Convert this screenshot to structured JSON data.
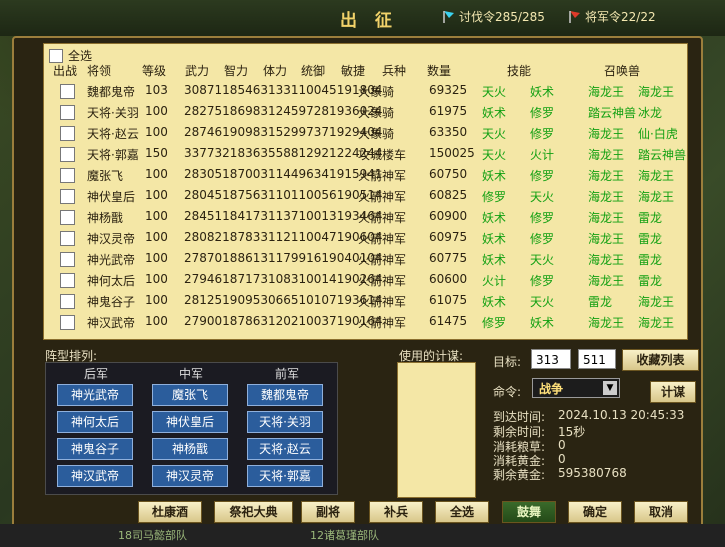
{
  "header": {
    "title": "出 征",
    "tao_fa": "讨伐令285/285",
    "jiang_jun": "将军令22/22"
  },
  "list": {
    "select_all": "全选",
    "columns": [
      "出战",
      "将领",
      "等级",
      "武力",
      "智力",
      "体力",
      "统御",
      "敏捷",
      "兵种",
      "数量",
      "技能",
      "召唤兽"
    ],
    "rows": [
      {
        "name": "魏都鬼帝",
        "level": "103",
        "stats": "30871185463133110045191804",
        "troop": "大象骑",
        "qty": "69325",
        "s1": "天火",
        "s2": "妖术",
        "b1": "海龙王",
        "b2": "海龙王"
      },
      {
        "name": "天将·关羽",
        "level": "100",
        "stats": "28275186983124597281936024",
        "troop": "大象骑",
        "qty": "61975",
        "s1": "妖术",
        "s2": "修罗",
        "b1": "踏云神兽",
        "b2": "冰龙"
      },
      {
        "name": "天将·赵云",
        "level": "100",
        "stats": "28746190983152997371929404",
        "troop": "大象骑",
        "qty": "63350",
        "s1": "天火",
        "s2": "修罗",
        "b1": "海龙王",
        "b2": "仙·白虎"
      },
      {
        "name": "天将·郭嘉",
        "level": "150",
        "stats": "33773218363558812921224244",
        "troop": "攻城楼车",
        "qty": "150025",
        "s1": "天火",
        "s2": "火计",
        "b1": "海龙王",
        "b2": "踏云神兽"
      },
      {
        "name": "魔张飞",
        "level": "100",
        "stats": "28305187003114496341915941",
        "troop": "火箭神军",
        "qty": "60750",
        "s1": "妖术",
        "s2": "修罗",
        "b1": "海龙王",
        "b2": "海龙王"
      },
      {
        "name": "神伏皇后",
        "level": "100",
        "stats": "28045187563110110056190514",
        "troop": "火箭神军",
        "qty": "60825",
        "s1": "修罗",
        "s2": "天火",
        "b1": "海龙王",
        "b2": "海龙王"
      },
      {
        "name": "神杨戬",
        "level": "100",
        "stats": "28451184173113710013193464",
        "troop": "火箭神军",
        "qty": "60900",
        "s1": "妖术",
        "s2": "修罗",
        "b1": "海龙王",
        "b2": "雷龙"
      },
      {
        "name": "神汉灵帝",
        "level": "100",
        "stats": "28082187833112110047190604",
        "troop": "火箭神军",
        "qty": "60975",
        "s1": "妖术",
        "s2": "修罗",
        "b1": "海龙王",
        "b2": "雷龙"
      },
      {
        "name": "神光武帝",
        "level": "100",
        "stats": "27870188613117991619040104",
        "troop": "火箭神军",
        "qty": "60775",
        "s1": "妖术",
        "s2": "天火",
        "b1": "海龙王",
        "b2": "雷龙"
      },
      {
        "name": "神何太后",
        "level": "100",
        "stats": "27946187173108310014190264",
        "troop": "火箭神军",
        "qty": "60600",
        "s1": "火计",
        "s2": "修罗",
        "b1": "海龙王",
        "b2": "雷龙"
      },
      {
        "name": "神鬼谷子",
        "level": "100",
        "stats": "28125190953066510107193614",
        "troop": "火箭神军",
        "qty": "61075",
        "s1": "妖术",
        "s2": "天火",
        "b1": "雷龙",
        "b2": "海龙王"
      },
      {
        "name": "神汉武帝",
        "level": "100",
        "stats": "27900187863120210037190164",
        "troop": "火箭神军",
        "qty": "61475",
        "s1": "修罗",
        "s2": "妖术",
        "b1": "海龙王",
        "b2": "海龙王"
      }
    ]
  },
  "formation": {
    "title": "阵型排列:",
    "headers": [
      "后军",
      "中军",
      "前军"
    ],
    "cells": [
      [
        "神光武帝",
        "魔张飞",
        "魏都鬼帝"
      ],
      [
        "神何太后",
        "神伏皇后",
        "天将·关羽"
      ],
      [
        "神鬼谷子",
        "神杨戬",
        "天将·赵云"
      ],
      [
        "神汉武帝",
        "神汉灵帝",
        "天将·郭嘉"
      ]
    ]
  },
  "strategy": {
    "title": "使用的计谋:"
  },
  "target": {
    "label": "目标:",
    "x": "313",
    "y": "511",
    "collect_btn": "收藏列表"
  },
  "command": {
    "label": "命令:",
    "value": "战争",
    "plan_btn": "计谋"
  },
  "info": {
    "arrive_label": "到达时间:",
    "arrive_value": "2024.10.13  20:45:33",
    "remain_label": "剩余时间:",
    "remain_value": "15秒",
    "food_label": "消耗粮草:",
    "food_value": "0",
    "gold_label": "消耗黄金:",
    "gold_value": "0",
    "left_gold_label": "剩余黄金:",
    "left_gold_value": "595380768"
  },
  "buttons": [
    "杜康酒",
    "祭祀大典",
    "副将",
    "补兵",
    "全选",
    "鼓舞",
    "确定",
    "取消"
  ],
  "bottom": {
    "left": "18司马懿部队",
    "right": "12诸葛瑾部队"
  }
}
